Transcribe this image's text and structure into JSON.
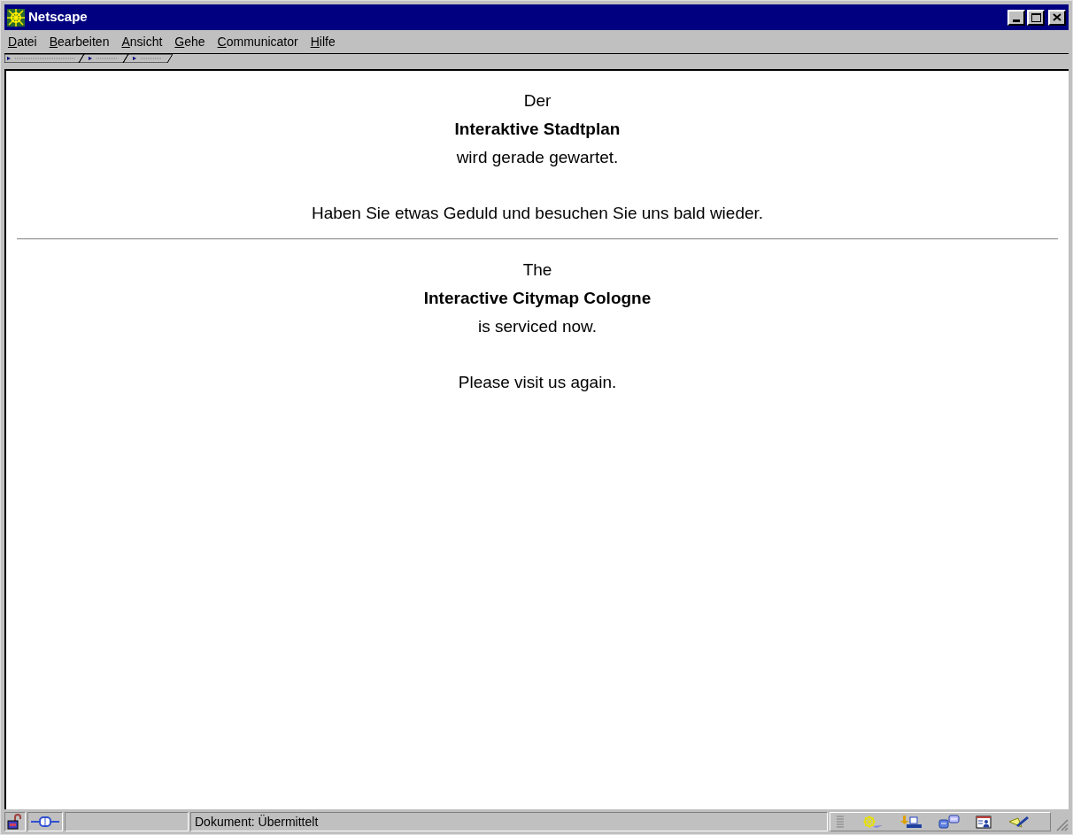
{
  "window": {
    "title": "Netscape"
  },
  "menu": [
    {
      "label": "Datei",
      "first_letter_underlined": true
    },
    {
      "label": "Bearbeiten",
      "first_letter_underlined": true
    },
    {
      "label": "Ansicht",
      "first_letter_underlined": true
    },
    {
      "label": "Gehe",
      "first_letter_underlined": true
    },
    {
      "label": "Communicator",
      "first_letter_underlined": true
    },
    {
      "label": "Hilfe",
      "first_letter_underlined": true
    }
  ],
  "progress": {
    "level": 0
  },
  "content": [
    {
      "kind": "line",
      "text": "Der"
    },
    {
      "kind": "strong",
      "text": "Interaktive Stadtplan"
    },
    {
      "kind": "line",
      "text": "wird gerade gewartet."
    },
    {
      "kind": "para",
      "text": "Haben Sie etwas Geduld und besuchen Sie uns bald wieder."
    },
    {
      "kind": "rule"
    },
    {
      "kind": "line",
      "text": "The"
    },
    {
      "kind": "strong",
      "text": "Interactive Citymap Cologne"
    },
    {
      "kind": "line",
      "text": "is serviced now."
    },
    {
      "kind": "para",
      "text": "Please visit us again."
    }
  ],
  "status_bar": {
    "text": "Dokument: Übermittelt"
  }
}
